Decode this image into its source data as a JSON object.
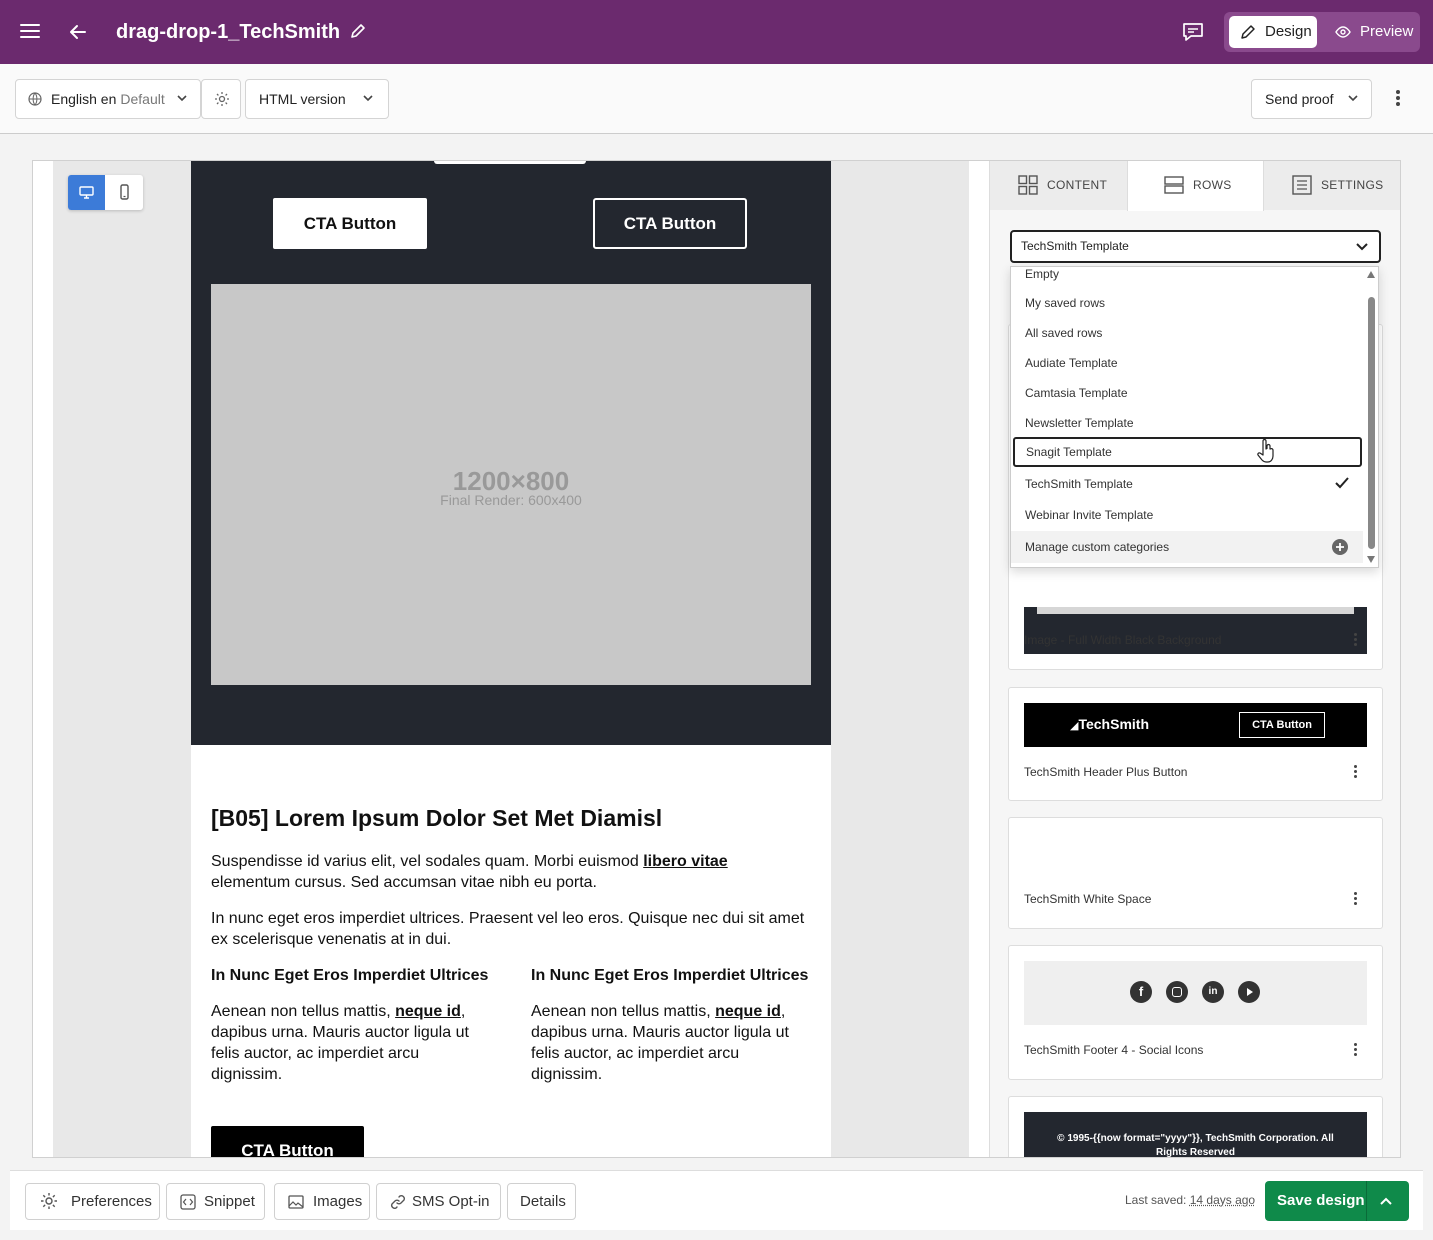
{
  "app": {
    "title": "drag-drop-1_TechSmith",
    "modes": {
      "design": "Design",
      "preview": "Preview"
    }
  },
  "toolbar": {
    "language": "English en",
    "language_default": "Default",
    "version": "HTML version",
    "send_proof": "Send proof"
  },
  "email": {
    "cta_white": "CTA Button",
    "cta_outline": "CTA Button",
    "placeholder_size": "1200×800",
    "placeholder_render": "Final Render: 600x400",
    "heading": "[B05] Lorem Ipsum Dolor Set Met Diamisl",
    "para1_before": "Suspendisse id varius elit, vel sodales quam. Morbi euismod ",
    "para1_link": "libero vitae",
    "para1_after": " elementum cursus. Sed accumsan vitae nibh eu porta.",
    "para2": "In nunc eget eros imperdiet ultrices. Praesent vel leo eros. Quisque nec dui sit amet ex scelerisque venenatis at in dui.",
    "col_heading": "In Nunc Eget Eros Imperdiet Ultrices",
    "col_before": "Aenean non tellus mattis, ",
    "col_link": "neque id",
    "col_after": ", dapibus urna. Mauris auctor ligula ut felis auctor, ac imperdiet arcu dignissim.",
    "cta_black": "CTA Button"
  },
  "panel": {
    "tabs": {
      "content": "CONTENT",
      "rows": "ROWS",
      "settings": "SETTINGS"
    },
    "category_selected": "TechSmith Template",
    "dropdown": {
      "items": [
        "Empty",
        "My saved rows",
        "All saved rows",
        "Audiate Template",
        "Camtasia Template",
        "Newsletter Template",
        "Snagit Template",
        "TechSmith Template",
        "Webinar Invite Template"
      ],
      "manage": "Manage custom categories"
    },
    "rows": {
      "card1": "Image - Full Width Black Background",
      "card2": "TechSmith Header Plus Button",
      "card2_logo": "TechSmith",
      "card2_cta": "CTA Button",
      "card3": "TechSmith White Space",
      "card4": "TechSmith Footer 4 - Social Icons",
      "card5_text": "© 1995-{{now format=\"yyyy\"}}, TechSmith Corporation. All Rights Reserved"
    }
  },
  "bottombar": {
    "preferences": "Preferences",
    "snippet": "Snippet",
    "images": "Images",
    "sms": "SMS Opt-in",
    "details": "Details",
    "last_saved_label": "Last saved:",
    "last_saved_value": "14 days ago",
    "save": "Save design"
  },
  "colors": {
    "topbar": "#6b2a6e",
    "accent_blue": "#3c7bd8",
    "save_green": "#0f8a4a",
    "email_dark": "#23272f"
  }
}
